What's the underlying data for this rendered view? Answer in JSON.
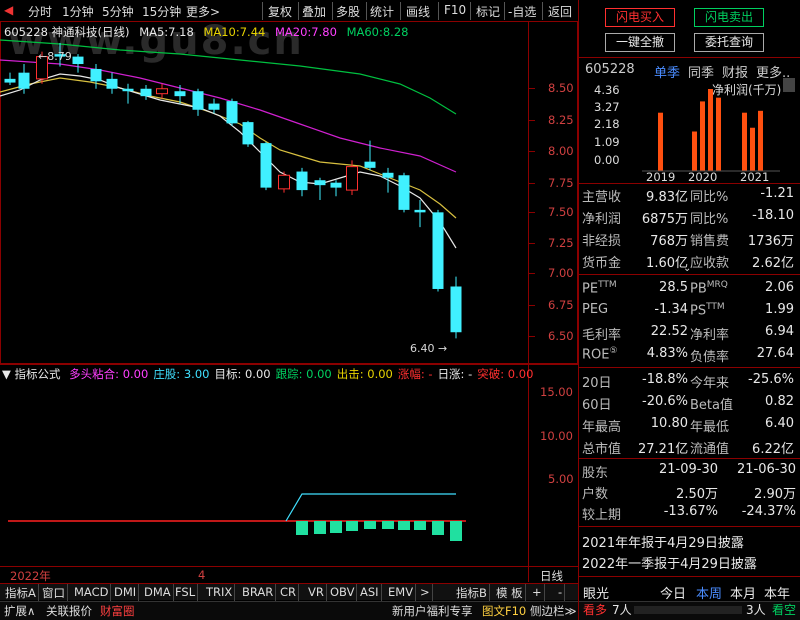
{
  "toolbar": {
    "items": [
      "分时",
      "1分钟",
      "5分钟",
      "15分钟",
      "更多>",
      "复权",
      "叠加",
      "多股",
      "统计",
      "画线",
      "F10",
      "标记",
      "-自选",
      "返回"
    ]
  },
  "stock": {
    "code_name": "605228 神通科技(日线)",
    "ma5_label": "MA5:",
    "ma5": "7.18",
    "ma10_label": "MA10:",
    "ma10": "7.44",
    "ma20_label": "MA20:",
    "ma20": "7.80",
    "ma60_label": "MA60:",
    "ma60": "8.28",
    "high_marker": "8.79",
    "low_marker": "6.40",
    "watermark": "www.gu8.cn"
  },
  "price_axis": [
    "8.50",
    "8.25",
    "8.00",
    "7.75",
    "7.50",
    "7.25",
    "7.00",
    "6.75",
    "6.50"
  ],
  "indicator": {
    "name": "指标公式",
    "items": [
      {
        "label": "多头粘合:",
        "value": "0.00",
        "color": "#ff40ff"
      },
      {
        "label": "庄股:",
        "value": "3.00",
        "color": "#40e0ff"
      },
      {
        "label": "目标:",
        "value": "0.00",
        "color": "#e8e8e8"
      },
      {
        "label": "跟踪:",
        "value": "0.00",
        "color": "#00d060"
      },
      {
        "label": "出击:",
        "value": "0.00",
        "color": "#e6d200"
      },
      {
        "label": "涨幅:",
        "value": "-",
        "color": "#ff3030"
      },
      {
        "label": "日涨:",
        "value": "-",
        "color": "#e8e8e8"
      },
      {
        "label": "突破:",
        "value": "0.00",
        "color": "#ff3030"
      }
    ],
    "axis": [
      "15.00",
      "10.00",
      "5.00"
    ]
  },
  "time_axis": {
    "year": "2022年",
    "month": "4",
    "period": "日线"
  },
  "tabs": [
    "指标A",
    "窗口",
    "MACD",
    "DMI",
    "DMA",
    "FSL",
    "TRIX",
    "BRAR",
    "CR",
    "VR",
    "OBV",
    "ASI",
    "EMV",
    ">",
    "指标B",
    "模 板",
    "+",
    "-"
  ],
  "bottom": {
    "expand": "扩展∧",
    "quote": "关联报价",
    "wealth": "财富圈",
    "promo": "新用户福利专享",
    "f10": "图文F10",
    "sidebar": "侧边栏≫",
    "eye": "眼光",
    "today": "今日",
    "week": "本周",
    "month": "本月",
    "year": "本年",
    "bull": "看多",
    "bull_count": "7人",
    "bear_count": "3人",
    "bear": "看空"
  },
  "right_panel": {
    "btn_buy": "闪电买入",
    "btn_sell": "闪电卖出",
    "btn_cancel_all": "一键全撤",
    "btn_query": "委托查询",
    "code": "605228",
    "tab_single": "单季",
    "tab_yoy": "同季",
    "tab_fin": "财报",
    "tab_more": "更多..",
    "mini_chart_title": "净利润(千万)",
    "mini_axis": [
      "4.36",
      "3.27",
      "2.18",
      "1.09",
      "0.00"
    ],
    "mini_years": [
      "2019",
      "2020",
      "2021"
    ],
    "mini_values": [
      3.1,
      0,
      2.1,
      3.7,
      4.36,
      3.9,
      0,
      3.1,
      2.3,
      3.2
    ],
    "fin": [
      {
        "l": "主营收",
        "v": "9.83亿",
        "l2": "同比%",
        "v2": "-1.21"
      },
      {
        "l": "净利润",
        "v": "6875万",
        "l2": "同比%",
        "v2": "-18.10"
      },
      {
        "l": "非经损",
        "v": "768万",
        "l2": "销售费",
        "v2": "1736万"
      },
      {
        "l": "货币金",
        "v": "1.60亿",
        "l2": "应收款",
        "v2": "2.62亿"
      }
    ],
    "val": [
      {
        "l": "PE",
        "sup": "TTM",
        "v": "28.5",
        "l2": "PB",
        "sup2": "MRQ",
        "v2": "2.06"
      },
      {
        "l": "PEG",
        "sup": "",
        "v": "-1.34",
        "l2": "PS",
        "sup2": "TTM",
        "v2": "1.99"
      },
      {
        "l": "毛利率",
        "sup": "",
        "v": "22.52",
        "l2": "净利率",
        "sup2": "",
        "v2": "6.94"
      },
      {
        "l": "ROE",
        "sup": "⑤",
        "v": "4.83%",
        "l2": "负债率",
        "sup2": "",
        "v2": "27.64"
      }
    ],
    "perf": [
      {
        "l": "20日",
        "v": "-18.8%",
        "l2": "今年来",
        "v2": "-25.6%"
      },
      {
        "l": "60日",
        "v": "-20.6%",
        "l2": "Beta值",
        "v2": "0.82"
      },
      {
        "l": "年最高",
        "v": "10.80",
        "l2": "年最低",
        "v2": "6.40"
      },
      {
        "l": "总市值",
        "v": "27.21亿",
        "l2": "流通值",
        "v2": "6.22亿"
      }
    ],
    "holders": {
      "label": "股东",
      "d1": "21-09-30",
      "d2": "21-06-30",
      "l_count": "户数",
      "c1": "2.50万",
      "c2": "2.90万",
      "l_cmp": "较上期",
      "p1": "-13.67%",
      "p2": "-24.37%"
    },
    "news1": "2021年年报于4月29日披露",
    "news2": "2022年一季报于4月29日披露"
  },
  "colors": {
    "up": "#ff3030",
    "down": "#40f0ff",
    "frame": "#8b0000"
  }
}
